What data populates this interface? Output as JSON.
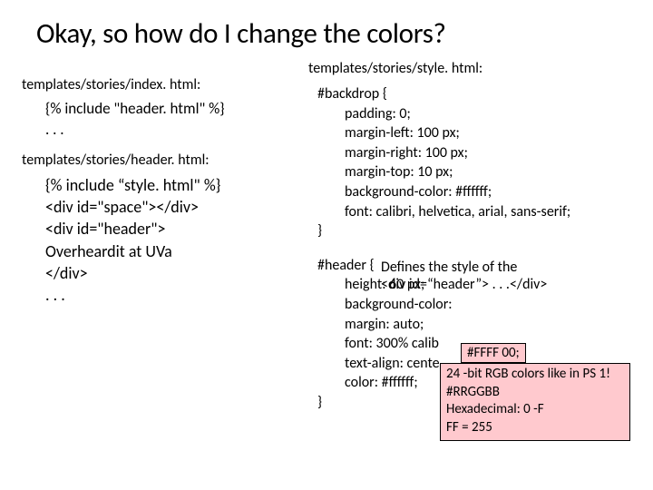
{
  "title": "Okay, so how do I change the colors?",
  "left": {
    "file1_label": "templates/stories/index. html:",
    "file1_code_l1": "{% include \"header. html\" %}",
    "file1_code_l2": ". . .",
    "file2_label": "templates/stories/header. html:",
    "file2_code_l1": "{% include “style. html\" %}",
    "file2_code_l2": "<div id=\"space\"></div>",
    "file2_code_l3": "<div id=\"header\">",
    "file2_code_l4": "Overheardit at UVa",
    "file2_code_l5": "</div>",
    "file2_code_l6": ". . ."
  },
  "right": {
    "file_label": "templates/stories/style. html:",
    "css": {
      "sel1": "#backdrop {",
      "p1": "padding: 0;",
      "p2": "margin-left: 100 px;",
      "p3": "margin-right: 100 px;",
      "p4": "margin-top: 10 px;",
      "p5": "background-color: #ffffff;",
      "p6": "font: calibri, helvetica, arial, sans-serif;",
      "close1": "}",
      "sel2": "#header {",
      "q1": "height: 60 px;",
      "q2": "background-color:",
      "q3": "margin: auto;",
      "q4": "font: 300% calib",
      "q5": "text-align: cente",
      "q6": "color: #ffffff;",
      "close2": "}"
    }
  },
  "annotations": {
    "define_l1": "Defines the style of the",
    "define_l2": "<div id=“header”> . . .</div>",
    "yellow": "#FFFF 00;",
    "box_l1": "24 -bit RGB colors like in PS 1!",
    "box_l2": "#RRGGBB",
    "box_l3": "Hexadecimal: 0 -F",
    "box_l4": "FF = 255"
  }
}
